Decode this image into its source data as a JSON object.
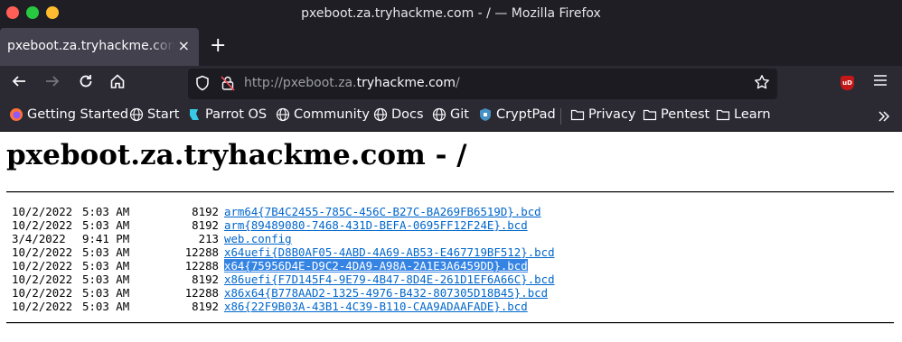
{
  "window": {
    "title": "pxeboot.za.tryhackme.com - / — Mozilla Firefox"
  },
  "tabs": [
    {
      "label": "pxeboot.za.tryhackme.com - /",
      "close": "×"
    }
  ],
  "new_tab": "+",
  "urlbar": {
    "prefix": "http://pxeboot.za.",
    "host": "tryhackme.com",
    "suffix": "/"
  },
  "bookmarks": [
    {
      "label": "Getting Started",
      "icon": "firefox-icon"
    },
    {
      "label": "Start",
      "icon": "globe-icon"
    },
    {
      "label": "Parrot OS",
      "icon": "parrot-icon"
    },
    {
      "label": "Community",
      "icon": "globe-icon"
    },
    {
      "label": "Docs",
      "icon": "globe-icon"
    },
    {
      "label": "Git",
      "icon": "globe-icon"
    },
    {
      "label": "CryptPad",
      "icon": "cryptpad-icon"
    },
    {
      "label": "Privacy",
      "icon": "folder-icon"
    },
    {
      "label": "Pentest",
      "icon": "folder-icon"
    },
    {
      "label": "Learn",
      "icon": "folder-icon"
    }
  ],
  "page": {
    "title": "pxeboot.za.tryhackme.com - /",
    "files": [
      {
        "date": "10/2/2022",
        "time": "5:03 AM",
        "size": "8192",
        "name": "arm64{7B4C2455-785C-456C-B27C-BA269FB6519D}.bcd",
        "selected": false
      },
      {
        "date": "10/2/2022",
        "time": "5:03 AM",
        "size": "8192",
        "name": "arm{89489080-7468-431D-BEFA-0695FF12F24E}.bcd",
        "selected": false
      },
      {
        "date": "3/4/2022",
        "time": "9:41 PM",
        "size": "213",
        "name": "web.config",
        "selected": false
      },
      {
        "date": "10/2/2022",
        "time": "5:03 AM",
        "size": "12288",
        "name": "x64uefi{D8B0AF05-4ABD-4A69-AB53-E467719BF512}.bcd",
        "selected": false
      },
      {
        "date": "10/2/2022",
        "time": "5:03 AM",
        "size": "12288",
        "name": "x64{75956D4E-D9C2-4DA9-A98A-2A1E3A6459DD}.bcd",
        "selected": true
      },
      {
        "date": "10/2/2022",
        "time": "5:03 AM",
        "size": "8192",
        "name": "x86uefi{F7D145F4-9E79-4B47-8D4E-261D1EF6A66C}.bcd",
        "selected": false
      },
      {
        "date": "10/2/2022",
        "time": "5:03 AM",
        "size": "12288",
        "name": "x86x64{B778AAD2-1325-4976-B432-807305D18B45}.bcd",
        "selected": false
      },
      {
        "date": "10/2/2022",
        "time": "5:03 AM",
        "size": "8192",
        "name": "x86{22F9B03A-43B1-4C39-B110-CAA9ADAAFADE}.bcd",
        "selected": false
      }
    ]
  },
  "colors": {
    "link": "#0066cc",
    "selection": "#3584e4",
    "chrome_dark": "#1f1e25",
    "toolbar": "#2b2a33"
  }
}
